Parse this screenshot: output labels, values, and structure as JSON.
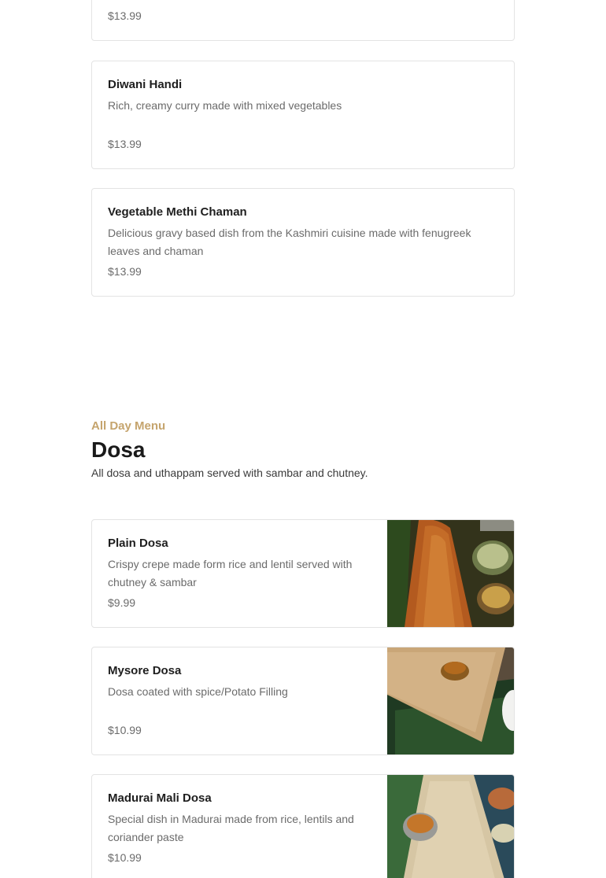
{
  "top_items": [
    {
      "name": "",
      "description": "",
      "price": "$13.99"
    },
    {
      "name": "Diwani Handi",
      "description": "Rich, creamy curry made with mixed vegetables",
      "price": "$13.99"
    },
    {
      "name": "Vegetable Methi Chaman",
      "description": "Delicious gravy based dish from the Kashmiri cuisine made with fenugreek leaves and chaman",
      "price": "$13.99"
    }
  ],
  "section": {
    "eyebrow": "All Day Menu",
    "title": "Dosa",
    "description": "All dosa and uthappam served with sambar and chutney."
  },
  "dosa_items": [
    {
      "name": "Plain Dosa",
      "description": "Crispy crepe made form rice and lentil served with chutney & sambar",
      "price": "$9.99",
      "image": "plain-dosa-photo"
    },
    {
      "name": "Mysore Dosa",
      "description": "Dosa coated with spice/Potato Filling",
      "price": "$10.99",
      "image": "mysore-dosa-photo"
    },
    {
      "name": "Madurai Mali Dosa",
      "description": "Special dish in Madurai made from rice, lentils and coriander paste",
      "price": "$10.99",
      "image": "madurai-mali-dosa-photo"
    }
  ],
  "colors": {
    "accent": "#c5a46d",
    "border": "#e3e3e3",
    "muted_text": "#6b6b6b"
  }
}
